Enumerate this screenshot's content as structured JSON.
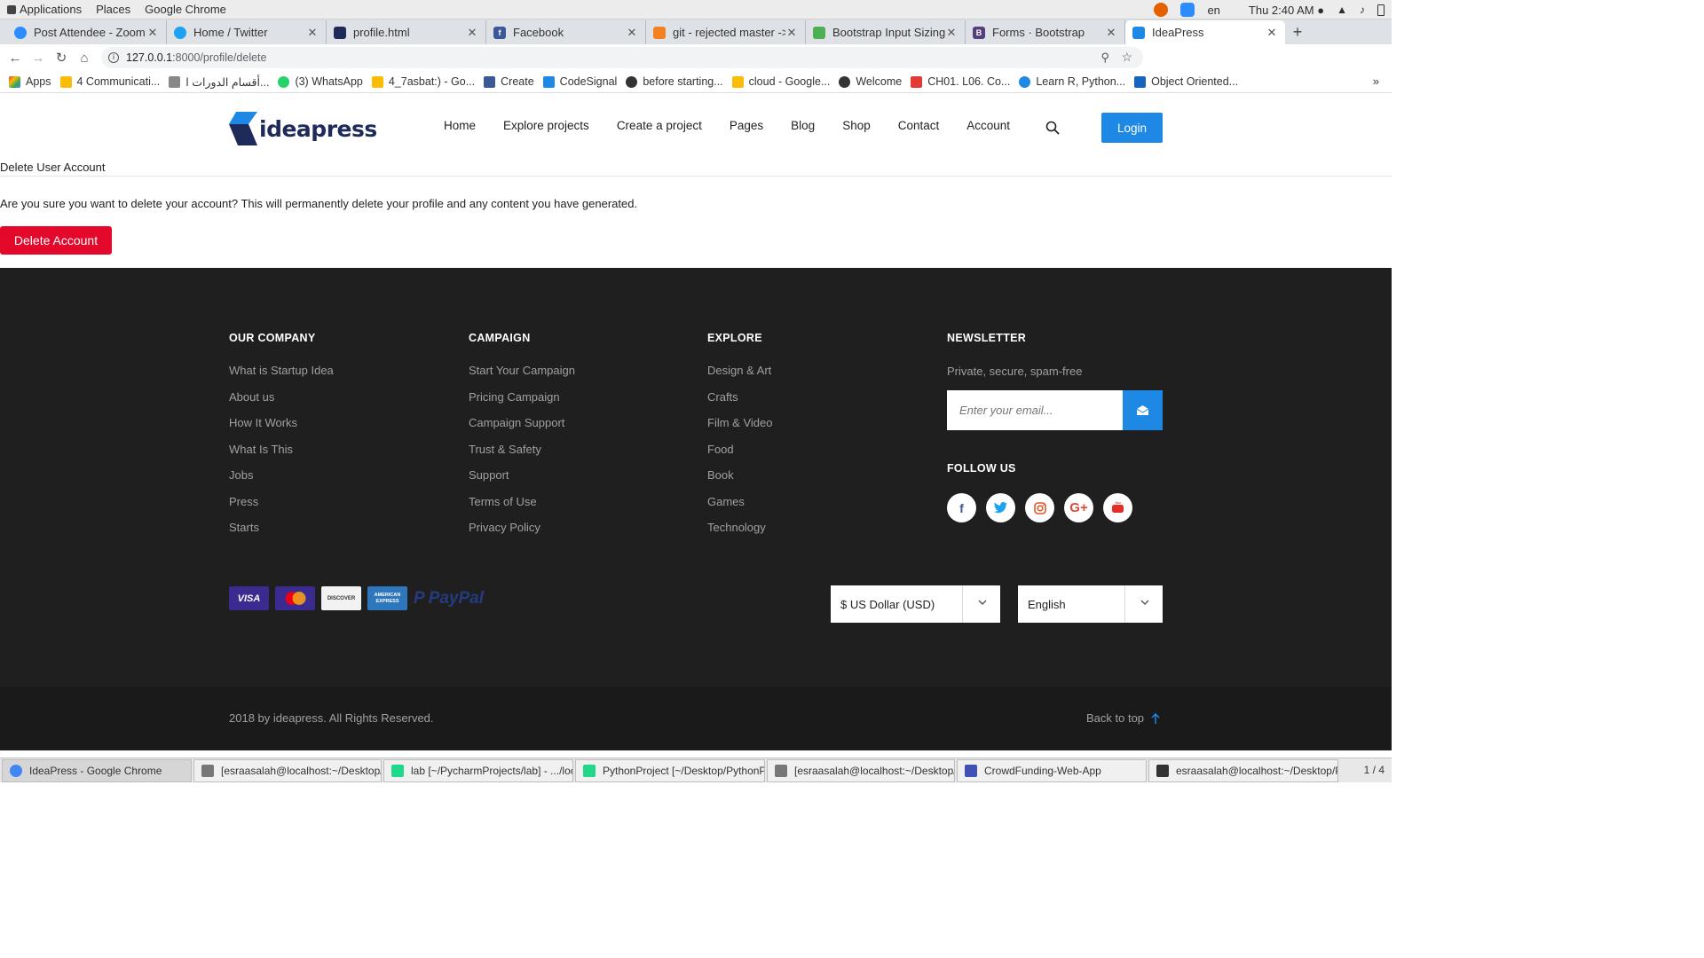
{
  "gnome": {
    "menus": [
      "Applications",
      "Places",
      "Google Chrome"
    ],
    "lang": "en",
    "clock": "Thu  2:40 AM ●"
  },
  "tabs": [
    {
      "title": "Post Attendee - Zoom",
      "color": "#2d8cff"
    },
    {
      "title": "Home / Twitter",
      "color": "#1da1f2"
    },
    {
      "title": "profile.html",
      "color": "#1e2a5a"
    },
    {
      "title": "Facebook",
      "color": "#3b5998"
    },
    {
      "title": "git - rejected master ->",
      "color": "#f48024"
    },
    {
      "title": "Bootstrap Input Sizing",
      "color": "#4caf50"
    },
    {
      "title": "Forms · Bootstrap",
      "color": "#563d7c"
    },
    {
      "title": "IdeaPress",
      "color": "#1e88e5"
    }
  ],
  "address": {
    "host": "127.0.0.1",
    "path": ":8000/profile/delete"
  },
  "bookmarks": [
    {
      "label": "Apps",
      "color": "#e53935"
    },
    {
      "label": "4 Communicati...",
      "color": "#fbbc05"
    },
    {
      "label": "أقسام الدورات ا...",
      "color": "#888888"
    },
    {
      "label": "(3) WhatsApp",
      "color": "#25d366"
    },
    {
      "label": "4_7asbat:) - Go...",
      "color": "#fbbc05"
    },
    {
      "label": "Create",
      "color": "#3b5998"
    },
    {
      "label": "CodeSignal",
      "color": "#1e88e5"
    },
    {
      "label": "before starting...",
      "color": "#333333"
    },
    {
      "label": "cloud - Google...",
      "color": "#fbbc05"
    },
    {
      "label": "Welcome",
      "color": "#333333"
    },
    {
      "label": "CH01. L06. Co...",
      "color": "#e53935"
    },
    {
      "label": "Learn R, Python...",
      "color": "#1e88e5"
    },
    {
      "label": "Object Oriented...",
      "color": "#1565c0"
    }
  ],
  "site": {
    "logo_a": "idea",
    "logo_b": "press",
    "nav": [
      "Home",
      "Explore projects",
      "Create a project",
      "Pages",
      "Blog",
      "Shop",
      "Contact",
      "Account"
    ],
    "login": "Login"
  },
  "content": {
    "heading": "Delete User Account",
    "confirm": "Are you sure you want to delete your account? This will permanently delete your profile and any content you have generated.",
    "delete_button": "Delete Account"
  },
  "footer": {
    "columns": [
      {
        "title": "OUR COMPANY",
        "items": [
          "What is Startup Idea",
          "About us",
          "How It Works",
          "What Is This",
          "Jobs",
          "Press",
          "Starts"
        ]
      },
      {
        "title": "CAMPAIGN",
        "items": [
          "Start Your Campaign",
          "Pricing Campaign",
          "Campaign Support",
          "Trust & Safety",
          "Support",
          "Terms of Use",
          "Privacy Policy"
        ]
      },
      {
        "title": "EXPLORE",
        "items": [
          "Design & Art",
          "Crafts",
          "Film & Video",
          "Food",
          "Book",
          "Games",
          "Technology"
        ]
      }
    ],
    "newsletter": {
      "title": "NEWSLETTER",
      "subtitle": "Private, secure, spam-free",
      "placeholder": "Enter your email..."
    },
    "follow": "FOLLOW US",
    "payments": [
      "VISA",
      "MasterCard",
      "DISCOVER",
      "AMERICAN EXPRESS",
      "PayPal"
    ],
    "currency": "$ US Dollar (USD)",
    "language": "English",
    "copyright": "2018 by ideapress. All Rights Reserved.",
    "back_to_top": "Back to top"
  },
  "taskbar": {
    "items": [
      {
        "label": "IdeaPress - Google Chrome",
        "color": "#4285f4"
      },
      {
        "label": "[esraasalah@localhost:~/Desktop/De...",
        "color": "#777777"
      },
      {
        "label": "lab [~/PycharmProjects/lab] - .../locall...",
        "color": "#21d789"
      },
      {
        "label": "PythonProject [~/Desktop/PythonPr...",
        "color": "#21d789"
      },
      {
        "label": "[esraasalah@localhost:~/Desktop/De...",
        "color": "#777777"
      },
      {
        "label": "CrowdFunding-Web-App",
        "color": "#3f51b5"
      },
      {
        "label": "esraasalah@localhost:~/Desktop/Pyt...",
        "color": "#333333"
      }
    ],
    "pager": "1 / 4"
  }
}
